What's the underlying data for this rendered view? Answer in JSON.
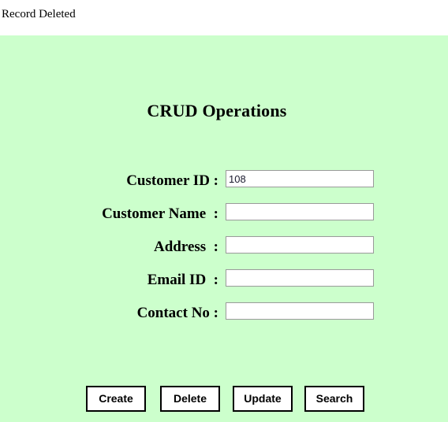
{
  "status": {
    "message": "Record Deleted"
  },
  "form": {
    "title": "CRUD Operations",
    "fields": [
      {
        "label": "Customer ID :",
        "value": "108",
        "placeholder": ""
      },
      {
        "label": "Customer Name  :",
        "value": "",
        "placeholder": ""
      },
      {
        "label": "Address  :",
        "value": "",
        "placeholder": ""
      },
      {
        "label": "Email ID  :",
        "value": "",
        "placeholder": ""
      },
      {
        "label": "Contact No :",
        "value": "",
        "placeholder": ""
      }
    ],
    "buttons": [
      {
        "label": "Create"
      },
      {
        "label": "Delete"
      },
      {
        "label": "Update"
      },
      {
        "label": "Search"
      }
    ]
  },
  "colors": {
    "panel_background": "#CCFFCC",
    "page_background": "#FFFFFF",
    "text": "#000000",
    "input_border": "#9A9A9A",
    "button_border": "#000000"
  }
}
